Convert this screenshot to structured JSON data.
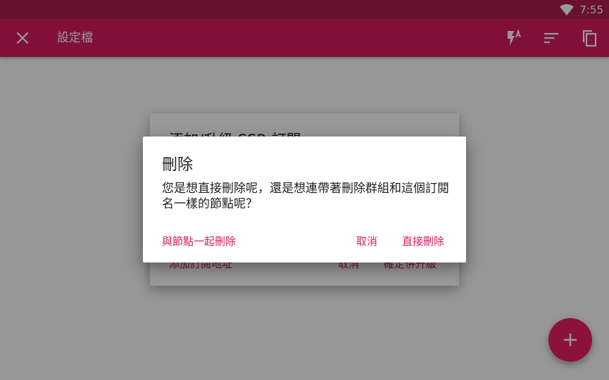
{
  "status_bar": {
    "time": "7:55",
    "wifi_icon": "wifi-icon"
  },
  "toolbar": {
    "title": "設定檔",
    "close_icon": "close-icon",
    "actions": [
      "flash-auto-icon",
      "sort-icon",
      "copy-icon"
    ]
  },
  "background_dialog": {
    "title": "添加/升級 SSR 訂閱",
    "add_link": "添加訂閱地址",
    "cancel": "取消",
    "confirm": "確定併升級"
  },
  "dialog": {
    "title": "刪除",
    "message": "您是想直接刪除呢，還是想連帶著刪除群組和這個訂閱名一樣的節點呢？",
    "btn_delete_with_nodes": "與節點一起刪除",
    "btn_cancel": "取消",
    "btn_delete_direct": "直接刪除"
  },
  "fab": {
    "icon": "plus-icon"
  },
  "colors": {
    "primary": "#d81b60",
    "primary_dark": "#ad1f4f",
    "accent": "#e91e63"
  }
}
